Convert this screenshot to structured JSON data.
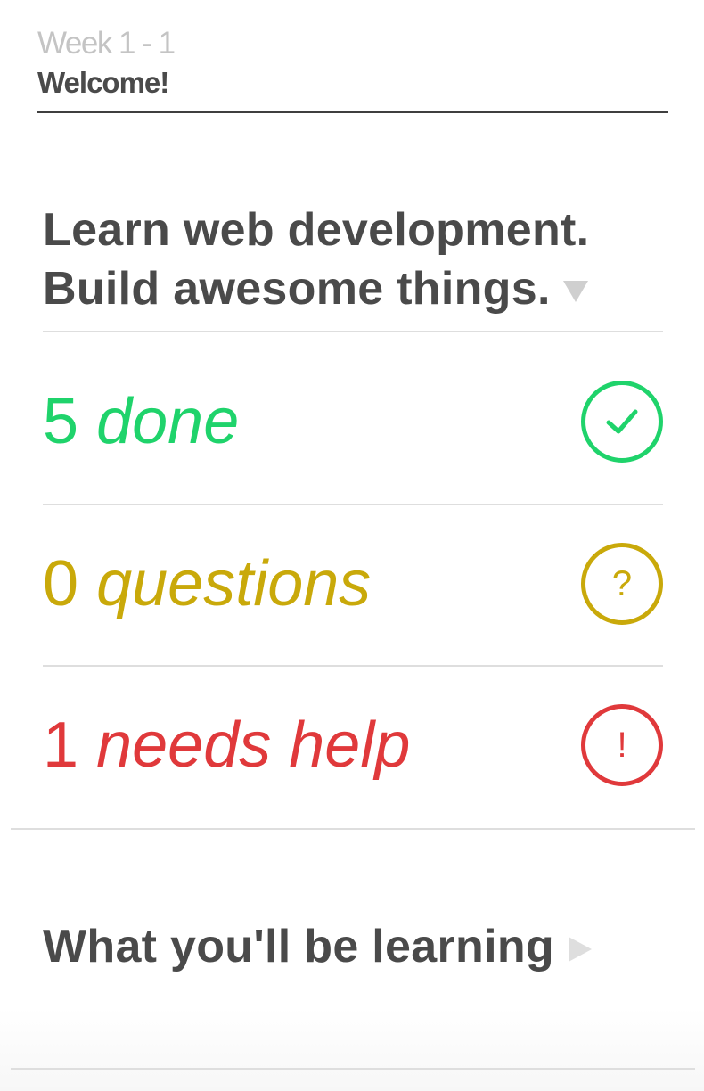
{
  "header": {
    "week": "Week 1 - 1",
    "lesson_title": "Welcome!"
  },
  "intro": {
    "headline_line1": "Learn web development.",
    "headline_line2": "Build awesome things.",
    "toggle_icon": "caret-down-icon"
  },
  "stats": [
    {
      "count": "5",
      "label": "done",
      "color": "#1fd36b",
      "icon": "check-circle-icon"
    },
    {
      "count": "0",
      "label": "questions",
      "color": "#c9a90a",
      "icon": "question-circle-icon",
      "glyph": "?"
    },
    {
      "count": "1",
      "label": "needs help",
      "color": "#e0393b",
      "icon": "exclamation-circle-icon",
      "glyph": "!"
    }
  ],
  "learning": {
    "title": "What you'll be learning",
    "expand_icon": "caret-right-icon"
  }
}
